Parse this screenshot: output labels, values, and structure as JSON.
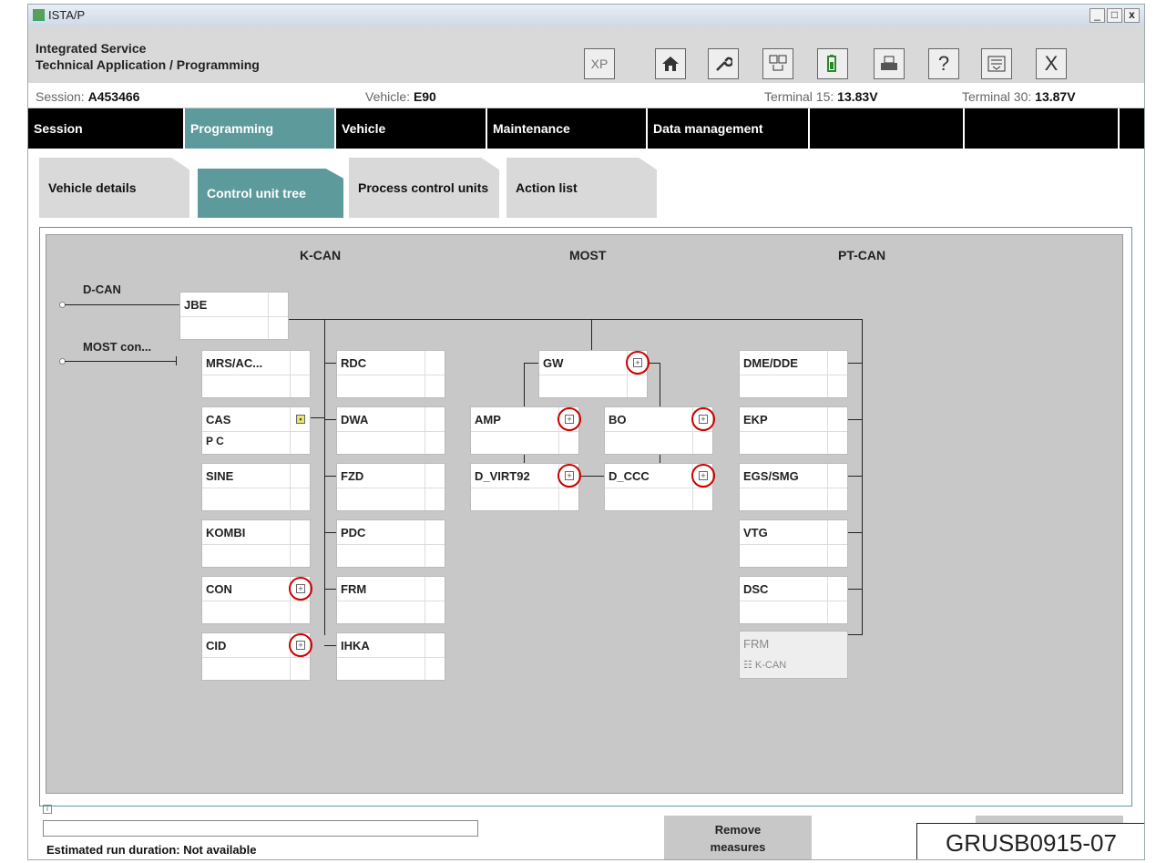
{
  "window": {
    "title": "ISTA/P",
    "controls": [
      "_",
      "□",
      "x"
    ]
  },
  "header": {
    "app_title_line1": "Integrated Service",
    "app_title_line2": "Technical Application / Programming",
    "toolbar": [
      "XP",
      "home-icon",
      "wrench-icon",
      "connect-icon",
      "battery-icon",
      "print-icon",
      "?",
      "list-icon",
      "X"
    ]
  },
  "status": {
    "session_label": "Session:",
    "session_value": "A453466",
    "vehicle_label": "Vehicle:",
    "vehicle_value": "E90",
    "t15_label": "Terminal 15:",
    "t15_value": "13.83V",
    "t30_label": "Terminal 30:",
    "t30_value": "13.87V"
  },
  "nav": [
    {
      "label": "Session"
    },
    {
      "label": "Programming",
      "active": true
    },
    {
      "label": "Vehicle"
    },
    {
      "label": "Maintenance"
    },
    {
      "label": "Data management"
    },
    {
      "label": ""
    },
    {
      "label": ""
    }
  ],
  "tabs": [
    {
      "label": "Vehicle details"
    },
    {
      "label": "Control unit tree",
      "active": true
    },
    {
      "label": "Process control units"
    },
    {
      "label": "Action list"
    }
  ],
  "tree": {
    "buses": {
      "kcan": "K-CAN",
      "most": "MOST",
      "ptcan": "PT-CAN"
    },
    "dcan": "D-CAN",
    "most_con": "MOST con...",
    "jbe": "JBE",
    "left": [
      "MRS/AC...",
      "CAS",
      "SINE",
      "KOMBI",
      "CON",
      "CID"
    ],
    "cas_sub": "P C",
    "mid": [
      "RDC",
      "DWA",
      "FZD",
      "PDC",
      "FRM",
      "IHKA"
    ],
    "most_units": {
      "gw": "GW",
      "amp": "AMP",
      "bo": "BO",
      "dvirt": "D_VIRT92",
      "dccc": "D_CCC"
    },
    "pt": [
      "DME/DDE",
      "EKP",
      "EGS/SMG",
      "VTG",
      "DSC"
    ],
    "frm_dis": "FRM",
    "frm_dis_sub": "K-CAN"
  },
  "bottom": {
    "estimated": "Estimated run duration: Not available",
    "remove_line1": "Remove",
    "remove_line2": "measures"
  },
  "stamp": "GRUSB0915-07"
}
